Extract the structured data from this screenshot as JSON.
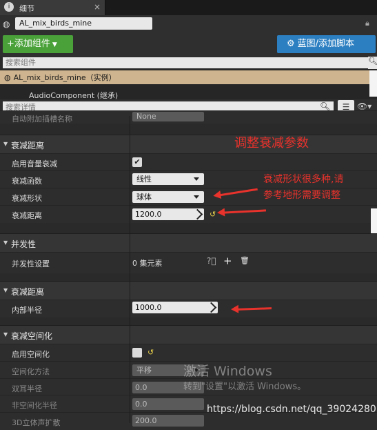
{
  "tab": {
    "title": "细节",
    "icon": "details-icon",
    "close": "×"
  },
  "actor": {
    "name": "AL_mix_birds_mine"
  },
  "toolbar": {
    "add_component": "添加组件",
    "blueprint": "蓝图/添加脚本"
  },
  "components_search": {
    "placeholder": "搜索组件"
  },
  "tree": {
    "root": "AL_mix_birds_mine（实例）",
    "child": "AudioComponent (继承)"
  },
  "details_search": {
    "placeholder": "搜索详情"
  },
  "partial_row": {
    "label": "自动附加插槽名称",
    "value": "None"
  },
  "sections": [
    {
      "title": "衰减距离",
      "rows": [
        {
          "label": "启用音量衰减",
          "checked": true
        },
        {
          "label": "衰减函数",
          "value": "线性"
        },
        {
          "label": "衰减形状",
          "value": "球体"
        },
        {
          "label": "衰减距离",
          "value": "1200.0"
        }
      ]
    },
    {
      "title": "并发性",
      "rows": [
        {
          "label": "并发性设置",
          "value": "0 集元素"
        }
      ]
    },
    {
      "title": "衰减距离",
      "rows": [
        {
          "label": "内部半径",
          "value": "1000.0"
        }
      ]
    },
    {
      "title": "衰减空间化",
      "rows": [
        {
          "label": "启用空间化",
          "checked": false
        },
        {
          "label": "空间化方法",
          "value": "平移"
        },
        {
          "label": "双耳半径",
          "value": "0.0"
        },
        {
          "label": "非空间化半径",
          "value": "0.0"
        },
        {
          "label": "3D立体声扩散",
          "value": "200.0"
        }
      ]
    }
  ],
  "annotations": {
    "heading": "调整衰减参数",
    "note_line1": "衰减形状很多种,请",
    "note_line2": "参考地形需要调整"
  },
  "watermark": {
    "activate_title": "激活 Windows",
    "activate_hint": "转到\"设置\"以激活 Windows。",
    "url": "https://blog.csdn.net/qq_39024280"
  },
  "colors": {
    "add_button": "#4aa13a",
    "blueprint_button": "#2c7fc1",
    "selection": "#cfb58f",
    "annotation": "#e8322c"
  }
}
